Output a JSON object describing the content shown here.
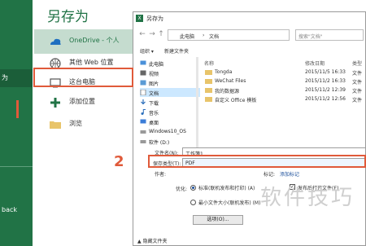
{
  "rail": {
    "active_item": "为",
    "bottom_item": "back"
  },
  "backstage": {
    "title": "另存为",
    "locations": [
      {
        "label": "OneDrive - 个人",
        "icon": "onedrive-icon",
        "sub": ""
      },
      {
        "label": "其他 Web 位置",
        "icon": "globe-icon"
      },
      {
        "label": "这台电脑",
        "icon": "computer-icon"
      },
      {
        "label": "添加位置",
        "icon": "plus-icon"
      },
      {
        "label": "浏览",
        "icon": "folder-icon"
      }
    ]
  },
  "dialog": {
    "title": "另存为",
    "address": {
      "segments": [
        "此电脑",
        "文档"
      ]
    },
    "search_placeholder": "搜索\"文档\"",
    "toolbar": {
      "organize": "组织 ▾",
      "new_folder": "新建文件夹"
    },
    "tree": [
      "此电脑",
      "视频",
      "图片",
      "文档",
      "下载",
      "音乐",
      "桌面",
      "Windows10_OS",
      "软件 (D:)"
    ],
    "columns": {
      "name": "名称",
      "date": "修改日期",
      "type": "类型"
    },
    "files": [
      {
        "name": "Tongda",
        "date": "2015/11/5 16:33",
        "type": "文件"
      },
      {
        "name": "WeChat Files",
        "date": "2015/11/2 16:33",
        "type": "文件"
      },
      {
        "name": "我的数据源",
        "date": "2015/11/2 12:39",
        "type": "文件"
      },
      {
        "name": "自定义 Office 模板",
        "date": "2015/11/2 12:56",
        "type": "文件"
      }
    ],
    "form": {
      "filename_label": "文件名(N):",
      "filename_value": "工作簿1",
      "savetype_label": "保存类型(T):",
      "savetype_value": "PDF",
      "author_label": "作者:",
      "tags_label": "标记:",
      "tags_placeholder": "添加标记",
      "optimize_label": "优化:",
      "option_standard": "标准(联机发布和打印) (A)",
      "option_minimum": "最小文件大小(联机发布) (M)",
      "open_after_publish": "发布后打开文件(E)",
      "options_button": "选项(O)...",
      "hide_folders": "隐藏文件夹"
    }
  },
  "annotations": {
    "mark_1": "1",
    "mark_2": "2"
  },
  "watermark": "软件技巧"
}
